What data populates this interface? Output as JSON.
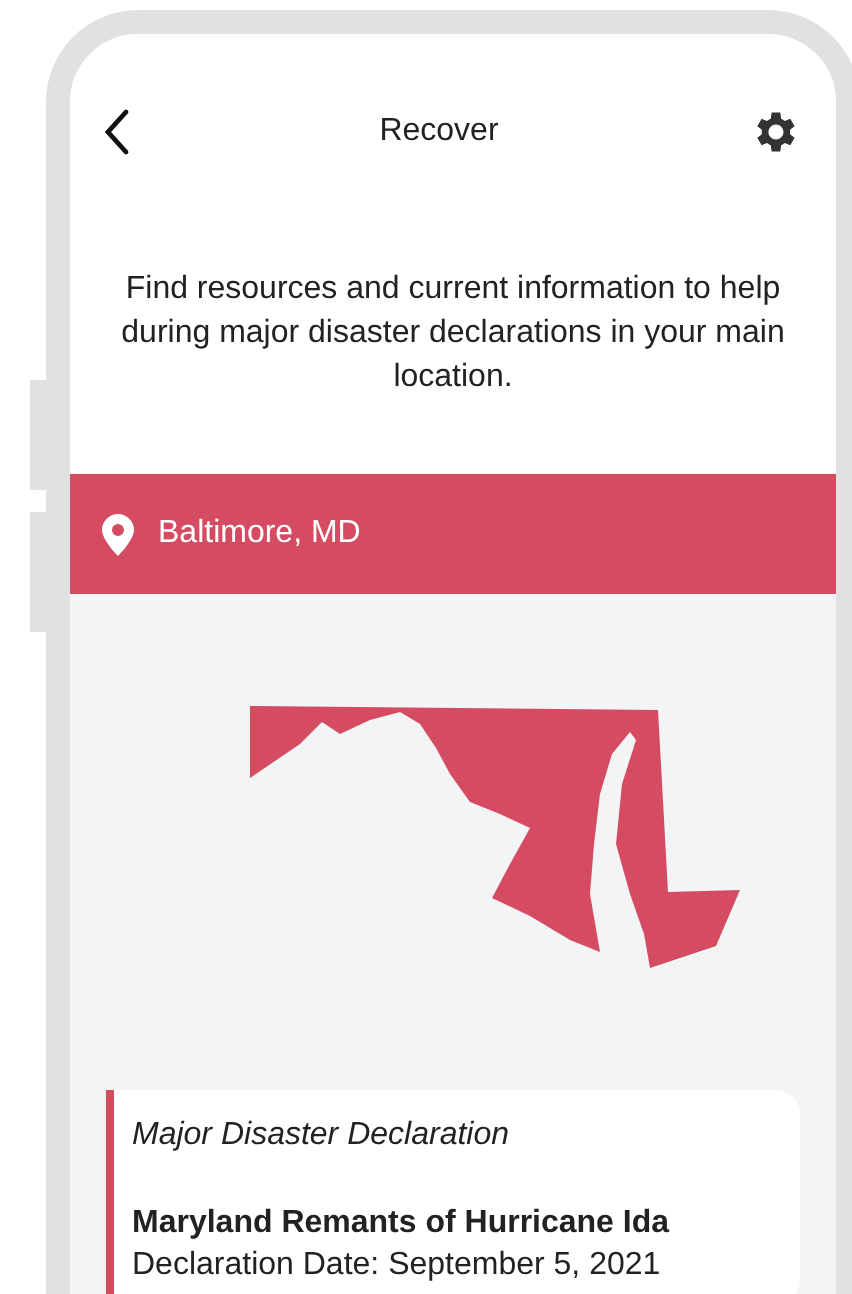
{
  "header": {
    "title": "Recover"
  },
  "intro": "Find resources and current information to help during major disaster declarations in your main location.",
  "location": {
    "name": "Baltimore, MD"
  },
  "declaration": {
    "type": "Major Disaster Declaration",
    "title": "Maryland Remants of Hurricane Ida",
    "date": "Declaration Date: September 5, 2021"
  }
}
